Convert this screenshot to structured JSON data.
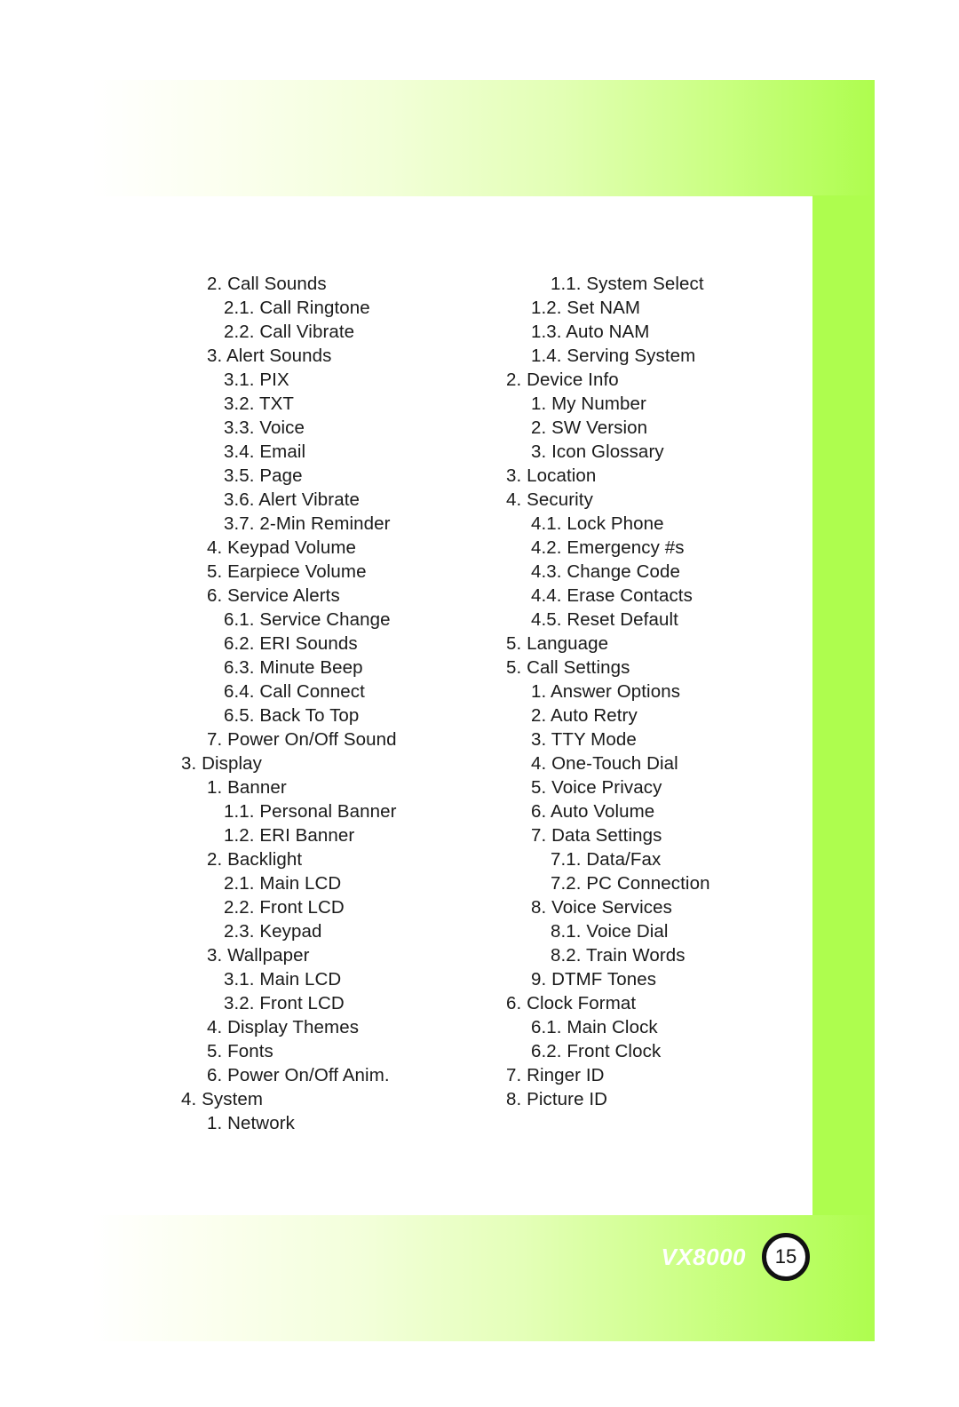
{
  "page": {
    "background_color": "#ffffff",
    "frame_accent_color": "#aefd4e"
  },
  "footer": {
    "model_name": "VX8000",
    "page_number": "15"
  },
  "menu": {
    "left_column": [
      {
        "level": 1,
        "label": "2. Call Sounds"
      },
      {
        "level": 2,
        "label": "2.1. Call Ringtone"
      },
      {
        "level": 2,
        "label": "2.2. Call Vibrate"
      },
      {
        "level": 1,
        "label": "3. Alert Sounds"
      },
      {
        "level": 2,
        "label": "3.1. PIX"
      },
      {
        "level": 2,
        "label": "3.2. TXT"
      },
      {
        "level": 2,
        "label": "3.3. Voice"
      },
      {
        "level": 2,
        "label": "3.4. Email"
      },
      {
        "level": 2,
        "label": "3.5. Page"
      },
      {
        "level": 2,
        "label": "3.6. Alert Vibrate"
      },
      {
        "level": 2,
        "label": "3.7. 2-Min Reminder"
      },
      {
        "level": 1,
        "label": "4. Keypad Volume"
      },
      {
        "level": 1,
        "label": "5. Earpiece Volume"
      },
      {
        "level": 1,
        "label": "6. Service Alerts"
      },
      {
        "level": 2,
        "label": "6.1. Service Change"
      },
      {
        "level": 2,
        "label": "6.2. ERI Sounds"
      },
      {
        "level": 2,
        "label": "6.3. Minute Beep"
      },
      {
        "level": 2,
        "label": "6.4. Call Connect"
      },
      {
        "level": 2,
        "label": "6.5. Back To Top"
      },
      {
        "level": 1,
        "label": "7. Power On/Off Sound"
      },
      {
        "level": 0,
        "label": "3. Display"
      },
      {
        "level": 1,
        "label": "1. Banner"
      },
      {
        "level": 2,
        "label": "1.1. Personal Banner"
      },
      {
        "level": 2,
        "label": "1.2. ERI Banner"
      },
      {
        "level": 1,
        "label": "2. Backlight"
      },
      {
        "level": 2,
        "label": "2.1. Main LCD"
      },
      {
        "level": 2,
        "label": "2.2. Front LCD"
      },
      {
        "level": 2,
        "label": "2.3. Keypad"
      },
      {
        "level": 1,
        "label": "3. Wallpaper"
      },
      {
        "level": 2,
        "label": "3.1. Main LCD"
      },
      {
        "level": 2,
        "label": "3.2. Front LCD"
      },
      {
        "level": 1,
        "label": "4. Display Themes"
      },
      {
        "level": 1,
        "label": "5. Fonts"
      },
      {
        "level": 1,
        "label": "6. Power On/Off Anim."
      },
      {
        "level": 0,
        "label": "4. System"
      },
      {
        "level": 1,
        "label": "1. Network"
      }
    ],
    "right_column": [
      {
        "level": 2,
        "label": "1.1. System Select"
      },
      {
        "level": 1,
        "label": "1.2. Set NAM"
      },
      {
        "level": 1,
        "label": "1.3. Auto NAM"
      },
      {
        "level": 1,
        "label": "1.4. Serving System"
      },
      {
        "level": 0,
        "label": "2. Device Info"
      },
      {
        "level": 1,
        "label": "1. My Number"
      },
      {
        "level": 1,
        "label": "2. SW Version"
      },
      {
        "level": 1,
        "label": "3. Icon Glossary"
      },
      {
        "level": 0,
        "label": "3. Location"
      },
      {
        "level": 0,
        "label": "4. Security"
      },
      {
        "level": 1,
        "label": "4.1. Lock Phone"
      },
      {
        "level": 1,
        "label": "4.2. Emergency #s"
      },
      {
        "level": 1,
        "label": "4.3. Change Code"
      },
      {
        "level": 1,
        "label": "4.4. Erase Contacts"
      },
      {
        "level": 1,
        "label": "4.5. Reset Default"
      },
      {
        "level": 0,
        "label": "5. Language"
      },
      {
        "level": 0,
        "label": "5. Call Settings"
      },
      {
        "level": 1,
        "label": "1. Answer Options"
      },
      {
        "level": 1,
        "label": "2. Auto Retry"
      },
      {
        "level": 1,
        "label": "3. TTY Mode"
      },
      {
        "level": 1,
        "label": "4. One-Touch Dial"
      },
      {
        "level": 1,
        "label": "5. Voice Privacy"
      },
      {
        "level": 1,
        "label": "6. Auto Volume"
      },
      {
        "level": 1,
        "label": "7. Data Settings"
      },
      {
        "level": 2,
        "label": "7.1. Data/Fax"
      },
      {
        "level": 2,
        "label": "7.2. PC Connection"
      },
      {
        "level": 1,
        "label": "8. Voice Services"
      },
      {
        "level": 2,
        "label": "8.1. Voice Dial"
      },
      {
        "level": 2,
        "label": "8.2. Train Words"
      },
      {
        "level": 1,
        "label": "9. DTMF Tones"
      },
      {
        "level": 0,
        "label": "6. Clock Format"
      },
      {
        "level": 1,
        "label": "6.1. Main Clock"
      },
      {
        "level": 1,
        "label": "6.2. Front Clock"
      },
      {
        "level": 0,
        "label": "7. Ringer ID"
      },
      {
        "level": 0,
        "label": "8. Picture ID"
      }
    ]
  }
}
